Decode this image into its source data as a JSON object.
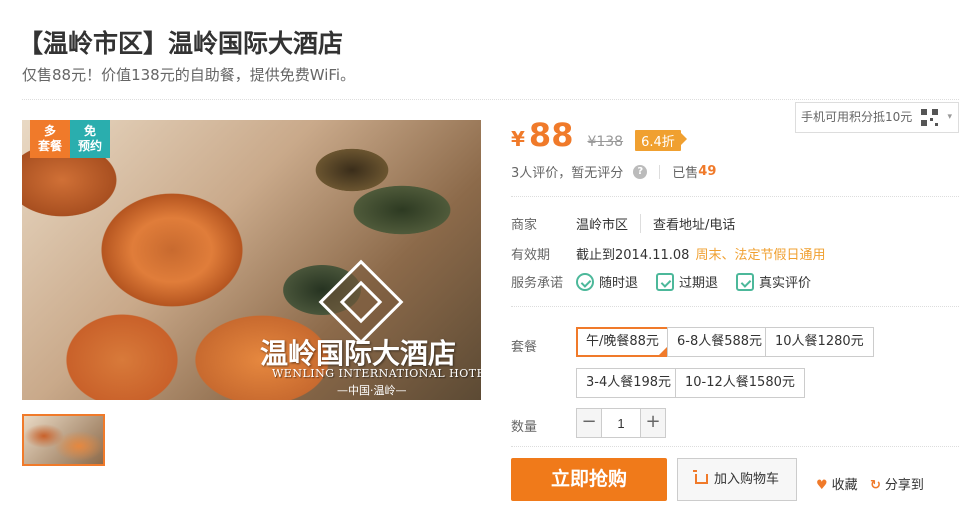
{
  "deal": {
    "title": "【温岭市区】温岭国际大酒店",
    "subtitle": "仅售88元！价值138元的自助餐，提供免费WiFi。"
  },
  "image": {
    "badge_multi_line1": "多",
    "badge_multi_line2": "套餐",
    "badge_free_line1": "免",
    "badge_free_line2": "预约",
    "hotel_name_cn": "温岭国际大酒店",
    "hotel_name_en": "WENLING INTERNATIONAL HOTEL",
    "hotel_location": "—中国·温岭—"
  },
  "pricing": {
    "currency": "¥",
    "price": "88",
    "original": "¥138",
    "discount": "6.4折"
  },
  "mobile_promo": {
    "text": "手机可用积分抵10元"
  },
  "rating": {
    "text": "3人评价，暂无评分",
    "help": "?",
    "sold_label": "已售",
    "sold_count": "49"
  },
  "merchant": {
    "label": "商家",
    "value": "温岭市区",
    "link": "查看地址/电话"
  },
  "validity": {
    "label": "有效期",
    "value": "截止到2014.11.08",
    "holiday": "周末、法定节假日通用"
  },
  "service": {
    "label": "服务承诺",
    "items": [
      "随时退",
      "过期退",
      "真实评价"
    ]
  },
  "packages": {
    "label": "套餐",
    "options": [
      "午/晚餐88元",
      "6-8人餐588元",
      "10人餐1280元",
      "3-4人餐198元",
      "10-12人餐1580元"
    ],
    "selected": "午/晚餐88元"
  },
  "quantity": {
    "label": "数量",
    "minus": "−",
    "plus": "+",
    "value": "1"
  },
  "actions": {
    "buy": "立即抢购",
    "cart": "加入购物车",
    "favorite": "收藏",
    "share": "分享到"
  },
  "colors": {
    "accent": "#f07a2a",
    "teal": "#2aaeae",
    "holiday": "#f0a030",
    "promise": "#4cb89a"
  }
}
